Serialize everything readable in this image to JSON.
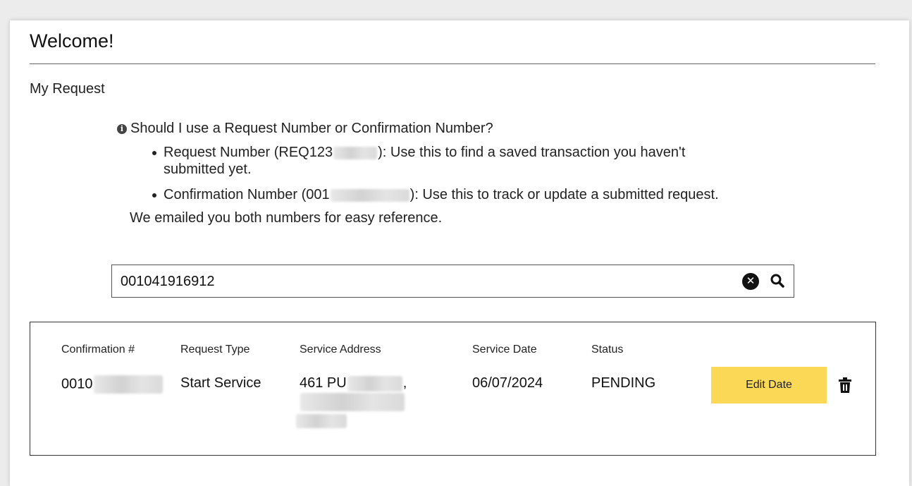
{
  "page": {
    "title": "Welcome!",
    "subtitle": "My Request"
  },
  "info": {
    "icon": "info-circle-icon",
    "question": "Should I use a Request Number or Confirmation Number?",
    "request_item": {
      "label_prefix": "Request Number (REQ123",
      "label_suffix": "): Use this to find a saved transaction you haven't submitted yet."
    },
    "confirmation_item": {
      "label_prefix": "Confirmation Number (001",
      "label_suffix": "): Use this to track or update a submitted request."
    },
    "note": "We emailed you both numbers for easy reference."
  },
  "search": {
    "value": "001041916912",
    "clear_icon": "close-circle-icon",
    "search_icon": "search-icon"
  },
  "results": {
    "headers": {
      "confirmation": "Confirmation #",
      "request_type": "Request Type",
      "service_address": "Service Address",
      "service_date": "Service Date",
      "status": "Status"
    },
    "row": {
      "confirmation": "0010",
      "request_type": "Start Service",
      "service_address": "461 PU",
      "service_address_sep": ",",
      "service_date": "06/07/2024",
      "status": "PENDING",
      "edit_label": "Edit Date",
      "delete_icon": "trash-icon"
    }
  },
  "colors": {
    "accent_button": "#fbd855",
    "border": "#333333"
  }
}
